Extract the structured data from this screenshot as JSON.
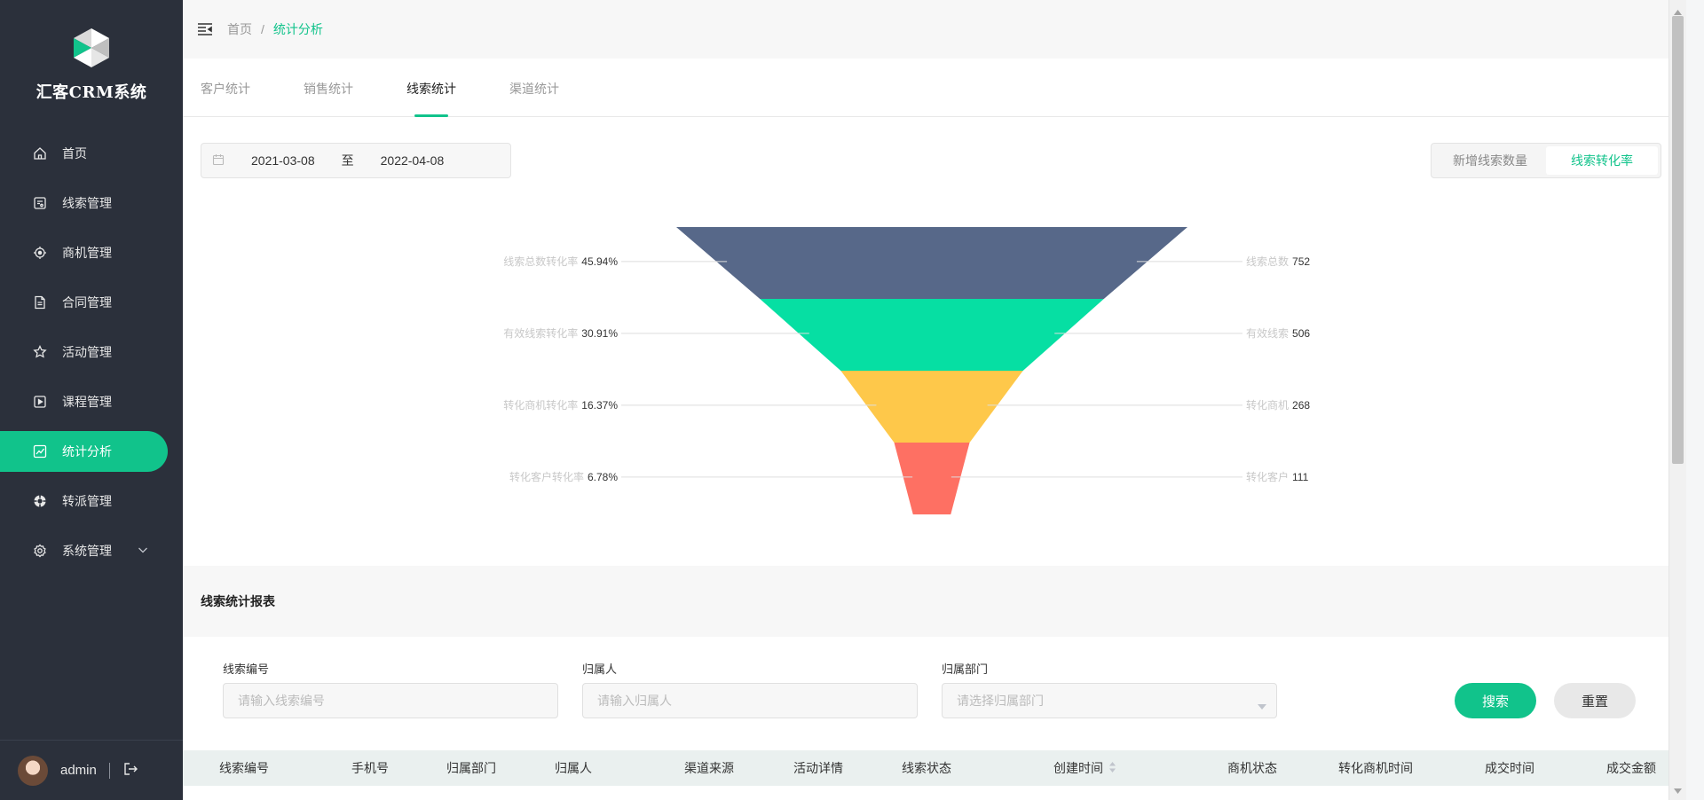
{
  "app": {
    "title": "汇客CRM系统"
  },
  "sidebar": {
    "items": [
      {
        "label": "首页",
        "icon": "home-icon"
      },
      {
        "label": "线索管理",
        "icon": "clue-icon"
      },
      {
        "label": "商机管理",
        "icon": "target-icon"
      },
      {
        "label": "合同管理",
        "icon": "document-icon"
      },
      {
        "label": "活动管理",
        "icon": "star-icon"
      },
      {
        "label": "课程管理",
        "icon": "play-icon"
      },
      {
        "label": "统计分析",
        "icon": "chart-icon",
        "active": true
      },
      {
        "label": "转派管理",
        "icon": "transfer-icon"
      },
      {
        "label": "系统管理",
        "icon": "gear-icon",
        "expandable": true
      }
    ],
    "user": {
      "name": "admin"
    }
  },
  "breadcrumb": {
    "home": "首页",
    "separator": "/",
    "current": "统计分析"
  },
  "tabs": [
    {
      "label": "客户统计"
    },
    {
      "label": "销售统计"
    },
    {
      "label": "线索统计",
      "active": true
    },
    {
      "label": "渠道统计"
    }
  ],
  "filters": {
    "start_date": "2021-03-08",
    "range_separator": "至",
    "end_date": "2022-04-08"
  },
  "toggle": {
    "options": [
      "新增线索数量",
      "线索转化率"
    ],
    "selected": "线索转化率"
  },
  "chart_data": {
    "type": "funnel",
    "stages": [
      {
        "name": "线索总数",
        "value": 752,
        "rate_label": "线索总数转化率",
        "rate": "45.94%",
        "color": "#576889"
      },
      {
        "name": "有效线索",
        "value": 506,
        "rate_label": "有效线索转化率",
        "rate": "30.91%",
        "color": "#06dfa3"
      },
      {
        "name": "转化商机",
        "value": 268,
        "rate_label": "转化商机转化率",
        "rate": "16.37%",
        "color": "#fec84a"
      },
      {
        "name": "转化客户",
        "value": 111,
        "rate_label": "转化客户转化率",
        "rate": "6.78%",
        "color": "#fe7063"
      }
    ]
  },
  "report": {
    "title": "线索统计报表",
    "fields": [
      {
        "label": "线索编号",
        "placeholder": "请输入线索编号"
      },
      {
        "label": "归属人",
        "placeholder": "请输入归属人"
      },
      {
        "label": "归属部门",
        "placeholder": "请选择归属部门"
      }
    ],
    "search_label": "搜索",
    "reset_label": "重置"
  },
  "table": {
    "columns": [
      "线索编号",
      "手机号",
      "归属部门",
      "归属人",
      "渠道来源",
      "活动详情",
      "线索状态",
      "创建时间",
      "商机状态",
      "转化商机时间",
      "成交时间",
      "成交金额"
    ]
  },
  "colors": {
    "accent": "#11c38b",
    "sidebar_bg": "#2b303b"
  }
}
